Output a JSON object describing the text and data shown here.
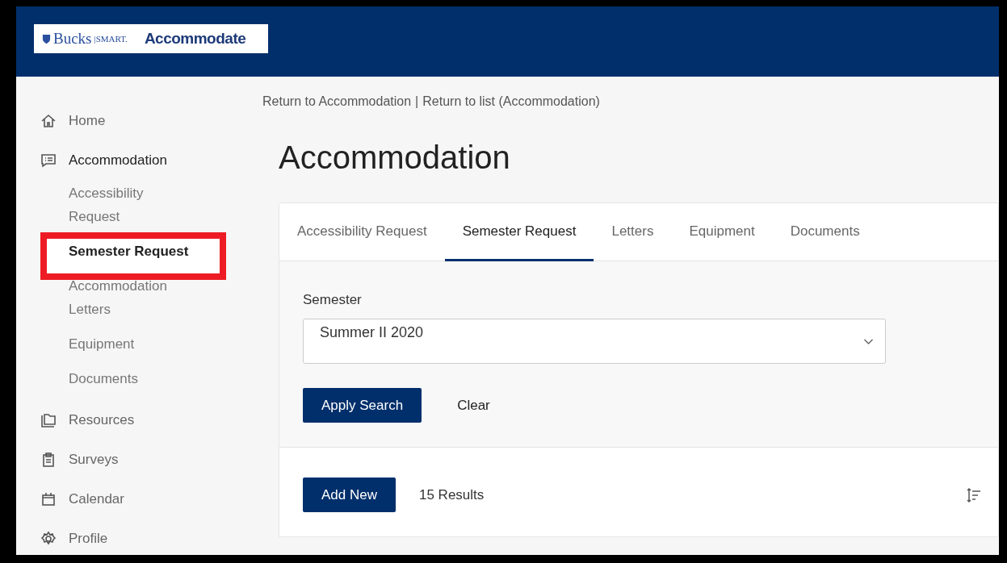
{
  "header": {
    "logo": {
      "college": "Bucks",
      "divider": "|SMART.",
      "product": "Accommodate"
    }
  },
  "sidebar": {
    "items": [
      {
        "label": "Home",
        "selected": false
      },
      {
        "label": "Accommodation",
        "selected": true,
        "children": [
          {
            "label": "Accessibility Request",
            "selected": false,
            "highlighted": false
          },
          {
            "label": "Semester Request",
            "selected": true,
            "highlighted": true
          },
          {
            "label": "Accommodation Letters",
            "selected": false,
            "highlighted": false
          },
          {
            "label": "Equipment",
            "selected": false,
            "highlighted": false
          },
          {
            "label": "Documents",
            "selected": false,
            "highlighted": false
          }
        ]
      },
      {
        "label": "Resources",
        "selected": false
      },
      {
        "label": "Surveys",
        "selected": false
      },
      {
        "label": "Calendar",
        "selected": false
      },
      {
        "label": "Profile",
        "selected": false
      }
    ]
  },
  "breadcrumb": {
    "separator": "|",
    "links": [
      "Return to Accommodation",
      "Return to list (Accommodation)"
    ]
  },
  "title": "Accommodation",
  "tabs": [
    {
      "label": "Accessibility Request",
      "selected": false
    },
    {
      "label": "Semester Request",
      "selected": true
    },
    {
      "label": "Letters",
      "selected": false
    },
    {
      "label": "Equipment",
      "selected": false
    },
    {
      "label": "Documents",
      "selected": false
    }
  ],
  "filter": {
    "label": "Semester",
    "value": "Summer II 2020",
    "buttons": [
      "Apply Search",
      "Clear"
    ]
  },
  "results": {
    "add_button": "Add New",
    "count": "15 Results"
  }
}
